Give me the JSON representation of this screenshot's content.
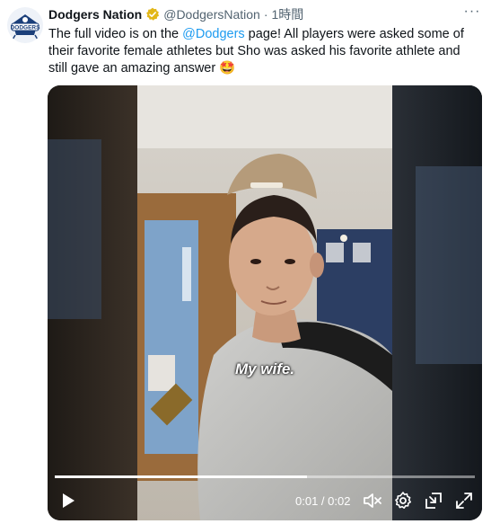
{
  "tweet": {
    "display_name": "Dodgers Nation",
    "handle": "@DodgersNation",
    "separator": "·",
    "time": "1時間",
    "text_before": "The full video is on the ",
    "mention": "@Dodgers",
    "text_after": " page! All players were asked some of their favorite female athletes but Sho was asked his favorite athlete and still gave an amazing answer 🤩",
    "avatar_text": "DODGERS",
    "more_label": "···"
  },
  "video": {
    "caption": "My wife.",
    "current_time": "0:01",
    "time_separator": " / ",
    "duration": "0:02",
    "progress_fraction": 0.6,
    "icons": [
      "play-icon",
      "volume-muted-icon",
      "settings-gear-icon",
      "picture-in-picture-icon",
      "fullscreen-icon"
    ]
  },
  "colors": {
    "link": "#1d9bf0",
    "verified_gold": "#e2b719",
    "muted_text": "#536471"
  }
}
